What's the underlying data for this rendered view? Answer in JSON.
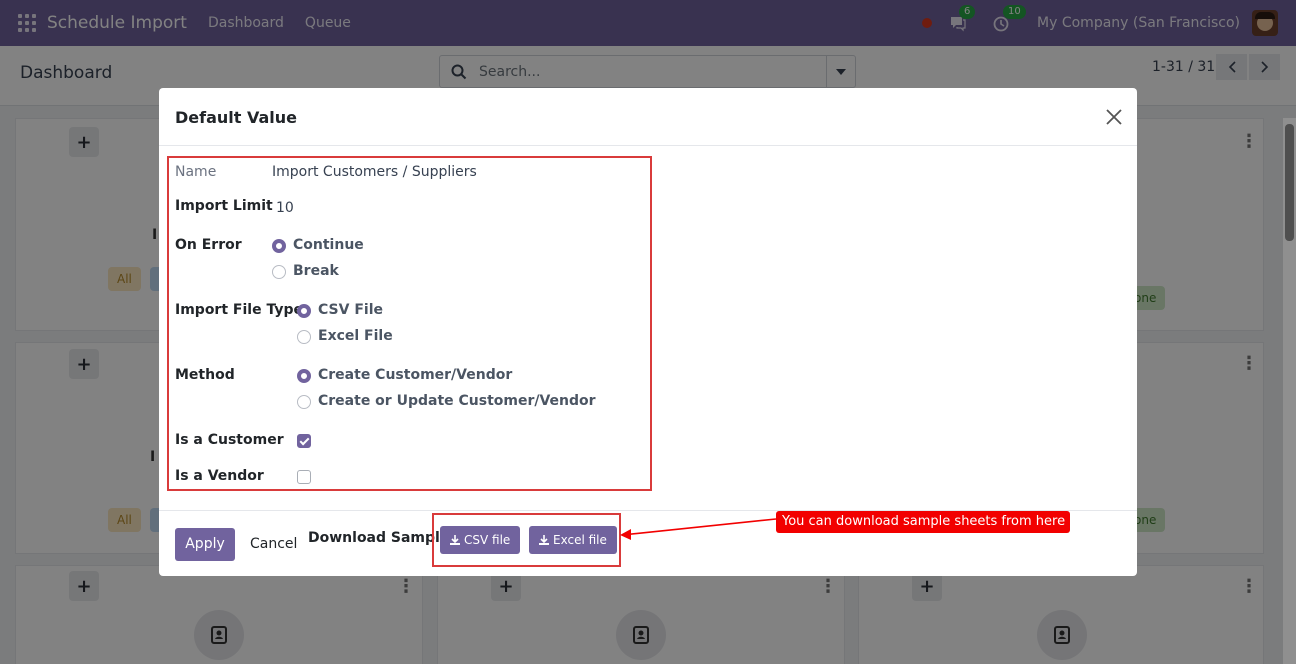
{
  "navbar": {
    "app_title": "Schedule Import",
    "menu": [
      "Dashboard",
      "Queue"
    ],
    "messages_count": "6",
    "activities_count": "10",
    "company": "My Company (San Francisco)"
  },
  "control_panel": {
    "breadcrumb": "Dashboard",
    "search_placeholder": "Search...",
    "pager": "1-31 / 31"
  },
  "background": {
    "pill_all": "All",
    "pill_done": "one",
    "card_text_fragment": "I"
  },
  "dialog": {
    "title": "Default Value",
    "fields": {
      "name_label": "Name",
      "name_value": "Import Customers / Suppliers",
      "import_limit_label": "Import Limit",
      "import_limit_value": "10",
      "on_error_label": "On Error",
      "on_error_options": [
        "Continue",
        "Break"
      ],
      "on_error_selected": "Continue",
      "file_type_label": "Import File Type",
      "file_type_options": [
        "CSV File",
        "Excel File"
      ],
      "file_type_selected": "CSV File",
      "method_label": "Method",
      "method_options": [
        "Create Customer/Vendor",
        "Create or Update Customer/Vendor"
      ],
      "method_selected": "Create Customer/Vendor",
      "is_customer_label": "Is a Customer",
      "is_customer_checked": true,
      "is_vendor_label": "Is a Vendor",
      "is_vendor_checked": false
    },
    "footer": {
      "apply_label": "Apply",
      "cancel_label": "Cancel",
      "download_label": "Download Sample:",
      "csv_button": "CSV file",
      "excel_button": "Excel file"
    }
  },
  "annotation": {
    "text": "You can download sample sheets from here"
  },
  "colors": {
    "brand": "#71639e",
    "highlight": "#d93b3b",
    "annotation": "#f20000"
  }
}
